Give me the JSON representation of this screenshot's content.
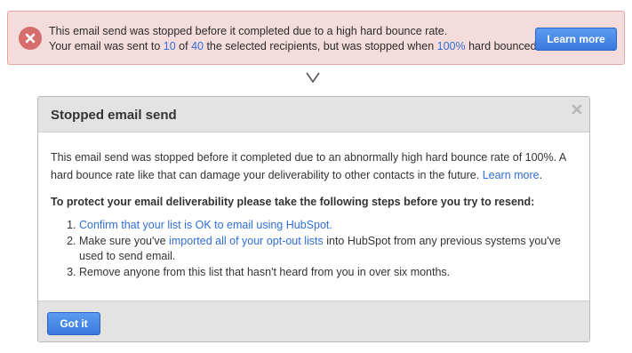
{
  "alert": {
    "line1": "This email send was stopped before it completed due to a high hard bounce rate.",
    "line2_a": "Your email was sent to ",
    "sent_count": "10",
    "line2_b": " of ",
    "total_count": "40",
    "line2_c": " the selected recipients, but was stopped  when ",
    "bounce_pct": "100%",
    "line2_d": " hard bounced.",
    "learn_more_button": "Learn more",
    "icon": "error-x-icon"
  },
  "chevron_icon": "chevron-down-icon",
  "modal": {
    "title": "Stopped email send",
    "close_icon": "close-icon",
    "body_text": "This email send was stopped before it completed due to an abnormally high hard bounce rate of 100%. A hard bounce rate like that can damage your deliverability to other contacts in the future. ",
    "body_link": "Learn more",
    "body_end": ".",
    "steps_heading": "To protect your email deliverability please take the following steps before you try to resend:",
    "step1_link": "Confirm that your list is OK to email using HubSpot.",
    "step2_a": "Make sure you've ",
    "step2_link": "imported all of your opt-out lists",
    "step2_b": " into HubSpot from any previous systems you've used to send email.",
    "step3": "Remove anyone from this list that hasn't heard from you in over six months.",
    "got_it_button": "Got it"
  },
  "colors": {
    "alert_bg": "#f5dcdc",
    "link": "#2f6fd6",
    "button": "#3a7ae0"
  }
}
